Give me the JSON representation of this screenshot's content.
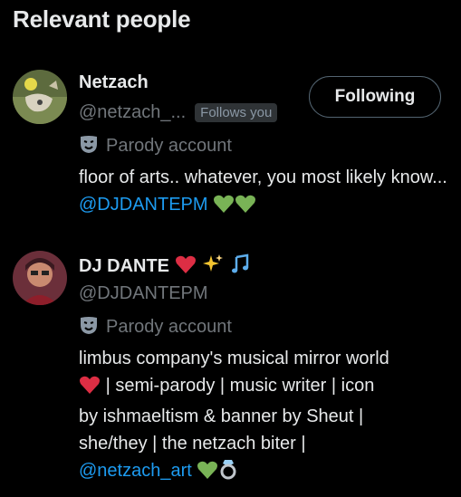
{
  "title": "Relevant people",
  "people": [
    {
      "name": "Netzach",
      "handle": "@netzach_...",
      "follows_you": "Follows you",
      "follow_button": "Following",
      "parody_label": "Parody account",
      "bio_text": "floor of arts.. whatever, you most likely know...",
      "bio_mention": "@DJDANTEPM",
      "bio_emojis": [
        "green-heart",
        "green-heart"
      ]
    },
    {
      "name": "DJ DANTE",
      "name_emojis": [
        "red-heart",
        "sparkles",
        "music-notes"
      ],
      "handle": "@DJDANTEPM",
      "parody_label": "Parody account",
      "bio_line1": "limbus company's musical mirror world",
      "bio_line2": "| semi-parody | music writer | icon",
      "bio_line3": "by ishmaeltism & banner by Sheut |",
      "bio_line4": "she/they | the netzach biter |",
      "bio_mention": "@netzach_art",
      "bio_emojis": [
        "green-heart",
        "ring"
      ]
    }
  ],
  "colors": {
    "background": "#000000",
    "text": "#e7e9ea",
    "secondary": "#71767b",
    "link": "#1d9bf0",
    "green_heart": "#79b356",
    "red_heart": "#dd2e44"
  }
}
